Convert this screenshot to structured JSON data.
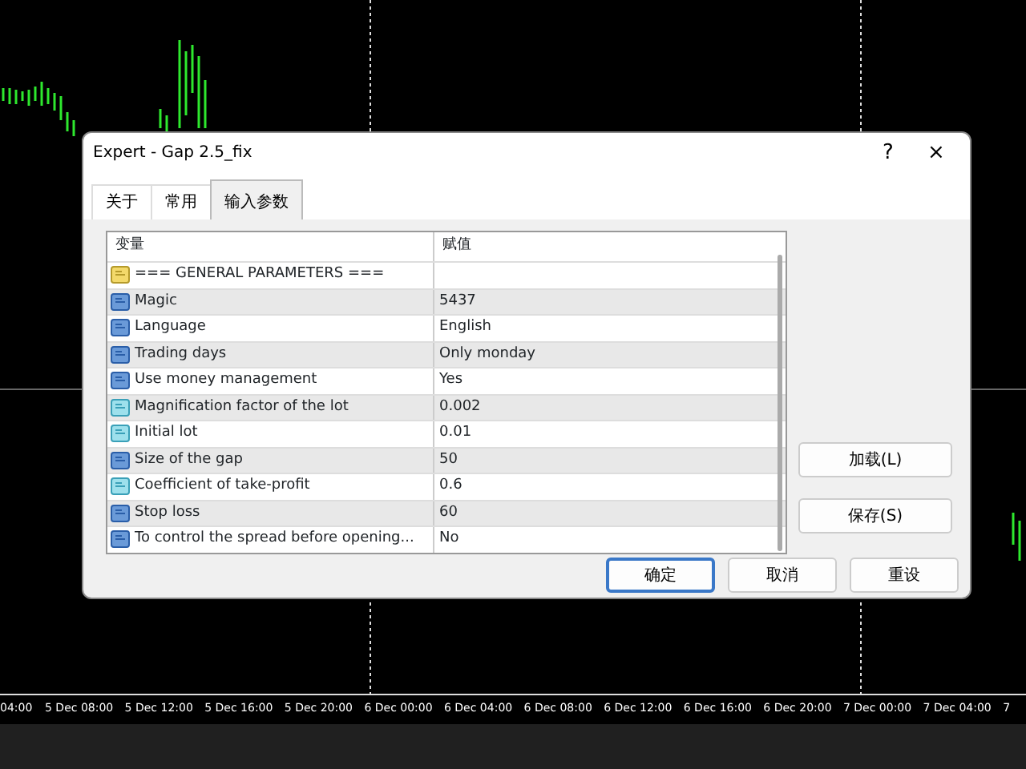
{
  "window": {
    "title": "Expert - Gap 2.5_fix",
    "help": "?",
    "close": "×"
  },
  "tabs": [
    {
      "label": "关于",
      "selected": false
    },
    {
      "label": "常用",
      "selected": false
    },
    {
      "label": "输入参数",
      "selected": true
    }
  ],
  "table": {
    "columns": [
      "变量",
      "赋值"
    ],
    "rows": [
      {
        "kind": "string",
        "variable": "=== GENERAL PARAMETERS ===",
        "value": ""
      },
      {
        "kind": "int",
        "variable": "Magic",
        "value": "5437"
      },
      {
        "kind": "int",
        "variable": "Language",
        "value": "English"
      },
      {
        "kind": "int",
        "variable": "Trading days",
        "value": "Only monday"
      },
      {
        "kind": "int",
        "variable": "Use money management",
        "value": "Yes"
      },
      {
        "kind": "double",
        "variable": "Magnification factor of the lot",
        "value": "0.002"
      },
      {
        "kind": "double",
        "variable": "Initial lot",
        "value": "0.01"
      },
      {
        "kind": "int",
        "variable": "Size of the gap",
        "value": "50"
      },
      {
        "kind": "double",
        "variable": "Coefficient of take-profit",
        "value": "0.6"
      },
      {
        "kind": "int",
        "variable": "Stop loss",
        "value": "60"
      },
      {
        "kind": "int",
        "variable": "To control the spread before opening...",
        "value": "No"
      }
    ]
  },
  "side_buttons": [
    "加载(L)",
    "保存(S)"
  ],
  "buttons": [
    {
      "label": "确定",
      "default": true
    },
    {
      "label": "取消",
      "default": false
    },
    {
      "label": "重设",
      "default": false
    }
  ],
  "time_axis": [
    "04:00",
    "5 Dec 08:00",
    "5 Dec 12:00",
    "5 Dec 16:00",
    "5 Dec 20:00",
    "6 Dec 00:00",
    "6 Dec 04:00",
    "6 Dec 08:00",
    "6 Dec 12:00",
    "6 Dec 16:00",
    "6 Dec 20:00",
    "7 Dec 00:00",
    "7 Dec 04:00",
    "7"
  ]
}
